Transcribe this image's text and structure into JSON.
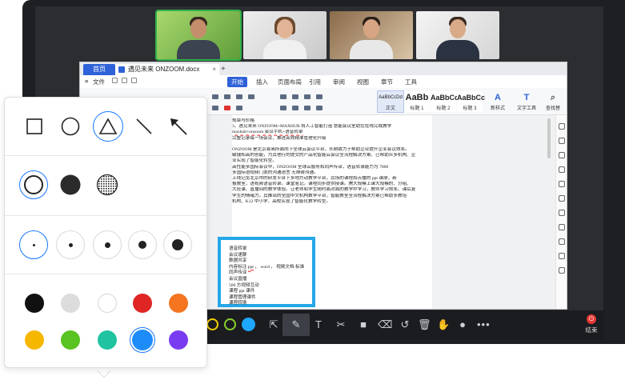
{
  "document": {
    "home_tab": "首页",
    "doc_tab": "遇见未来 ONZOOM.docx",
    "tab_close": "×",
    "tab_add": "+",
    "menu": {
      "file": "文件",
      "start": "开始",
      "insert": "插入",
      "layout": "页面布局",
      "reference": "引用",
      "review": "审阅",
      "view": "视图",
      "chapter": "章节",
      "tools": "工具"
    },
    "styles": [
      {
        "preview": "AaBbCcDd",
        "name": "正文"
      },
      {
        "preview": "AaBb",
        "name": "标题 1"
      },
      {
        "preview": "AaBbCc",
        "name": "标题 2"
      },
      {
        "preview": "AaBbCc",
        "name": "标题 3"
      }
    ],
    "new_style": "新样式",
    "text_tools": "文字工具",
    "find_replace": "查找替",
    "body_lines": [
      "规章与价格",
      "3、遇见未来 ONZOOM+MAXHUB 将人工智能打造 慧能会议室助您在线完成教学",
      "",
      "maxhub+onzoom 会议手机+语音转录",
      "完整记录每一场会议，推进高效精准管理化升级",
      "",
      "ONZOOM 是北京易简所面向下全球云会议平台，长期致力于帮助企业提升企业会议效率。",
      "敏捷和高的创能，为其他行的提交的产品化智能云会议全流程解决方案。已帮助众多机构、企",
      "业实现了智能化转型。",
      "    高性能多国际会议中，ONZOOM 全球云服务和同声传译，语音转录能力为 7000",
      "多国际语视频门类的沟通语言 无障碍沟通。",
      "    上线记览北京市的研发平台下多地方动教学平台，其场的课程和点播的 ppt 课册，新",
      "报教室，语视频语音转录。课堂笔记。课程同步提供授课。腾大规模上课大规模的、分组、",
      "大班课、直播间的教学体验。让老师和学生随时面对面的教学中学习，教师学习效率、课后复",
      "学生的情绪力。其推出的全国中文机构数学平台，智能教室全流程解决方案已帮助多教培",
      "机构、K12 中小学、高校实现了智能化教学转型。"
    ],
    "highlight_lines": [
      "语音转录",
      "会议速聊",
      "数据共享",
      "内容标注",
      "同声传译",
      "会议直播",
      "500 方视频互动",
      "课程 ppt 课件",
      "课程管理课件",
      "课程转换"
    ],
    "highlight_share_line": {
      "pre": "内容标注 ",
      "ppt": "ppt",
      "mid": " ， word ， 视频文档 标准"
    }
  },
  "toolbar": {
    "end_label": "结束",
    "end_icon": "⏻",
    "color_circles": [
      "#f5d000",
      "#8bd22f",
      "#1ea7ff"
    ],
    "icons": [
      "cursor-icon",
      "pen-icon",
      "text-icon",
      "scissors-icon",
      "shapes-icon",
      "eraser-icon",
      "undo-icon",
      "trash-icon",
      "hand-icon",
      "more-icon"
    ]
  },
  "panel": {
    "shapes": [
      "square-icon",
      "circle-icon",
      "triangle-icon",
      "line-icon",
      "arrow-icon"
    ],
    "selected_shape": "triangle-icon",
    "fills": [
      "outline-fill",
      "solid-fill",
      "mosaic-fill"
    ],
    "selected_fill": "outline-fill",
    "sizes": [
      "size-1",
      "size-2",
      "size-3",
      "size-4",
      "size-5"
    ],
    "selected_size": "size-1",
    "colors": [
      "#111111",
      "#dcdcdc",
      "#ffffff",
      "#e02525",
      "#f5741f",
      "#f5b700",
      "#58c322",
      "#1fc3a1",
      "#1d8cf8",
      "#7a3cf0"
    ],
    "selected_color": "#1d8cf8"
  }
}
